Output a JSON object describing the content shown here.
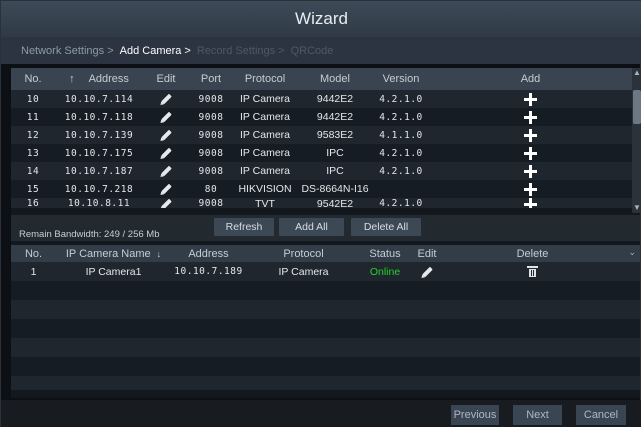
{
  "title": "Wizard",
  "steps": [
    {
      "label": "Network Settings >",
      "state": "done"
    },
    {
      "label": "Add Camera >",
      "state": "active"
    },
    {
      "label": "Record Settings >",
      "state": "future"
    },
    {
      "label": "QRCode",
      "state": "future"
    }
  ],
  "device_table": {
    "headers": {
      "no": "No.",
      "sort": "↑",
      "address": "Address",
      "edit": "Edit",
      "port": "Port",
      "protocol": "Protocol",
      "model": "Model",
      "version": "Version",
      "add": "Add"
    },
    "rows": [
      {
        "no": "10",
        "address": "10.10.7.114",
        "port": "9008",
        "protocol": "IP Camera",
        "model": "9442E2",
        "version": "4.2.1.0"
      },
      {
        "no": "11",
        "address": "10.10.7.118",
        "port": "9008",
        "protocol": "IP Camera",
        "model": "9442E2",
        "version": "4.2.1.0"
      },
      {
        "no": "12",
        "address": "10.10.7.139",
        "port": "9008",
        "protocol": "IP Camera",
        "model": "9583E2",
        "version": "4.1.1.0"
      },
      {
        "no": "13",
        "address": "10.10.7.175",
        "port": "9008",
        "protocol": "IP Camera",
        "model": "IPC",
        "version": "4.2.1.0"
      },
      {
        "no": "14",
        "address": "10.10.7.187",
        "port": "9008",
        "protocol": "IP Camera",
        "model": "IPC",
        "version": "4.2.1.0"
      },
      {
        "no": "15",
        "address": "10.10.7.218",
        "port": "80",
        "protocol": "HIKVISION",
        "model": "DS-8664N-I16",
        "version": ""
      },
      {
        "no": "16",
        "address": "10.10.8.11",
        "port": "9008",
        "protocol": "TVT",
        "model": "9542E2",
        "version": "4.2.1.0"
      }
    ]
  },
  "bandwidth": "Remain Bandwidth: 249 / 256 Mb",
  "actions": {
    "refresh": "Refresh",
    "add_all": "Add All",
    "delete_all": "Delete All"
  },
  "added_table": {
    "headers": {
      "no": "No.",
      "name": "IP Camera Name",
      "sort": "↓",
      "address": "Address",
      "protocol": "Protocol",
      "status": "Status",
      "edit": "Edit",
      "delete": "Delete"
    },
    "rows": [
      {
        "no": "1",
        "name": "IP Camera1",
        "address": "10.10.7.189",
        "protocol": "IP Camera",
        "status": "Online"
      }
    ]
  },
  "footer": {
    "previous": "Previous",
    "next": "Next",
    "cancel": "Cancel"
  },
  "colors": {
    "online": "#25d32c",
    "header": "#3a4450",
    "button": "#3d4855"
  },
  "icons": {
    "edit": "pencil-icon",
    "add": "plus-icon",
    "delete": "trash-icon"
  }
}
